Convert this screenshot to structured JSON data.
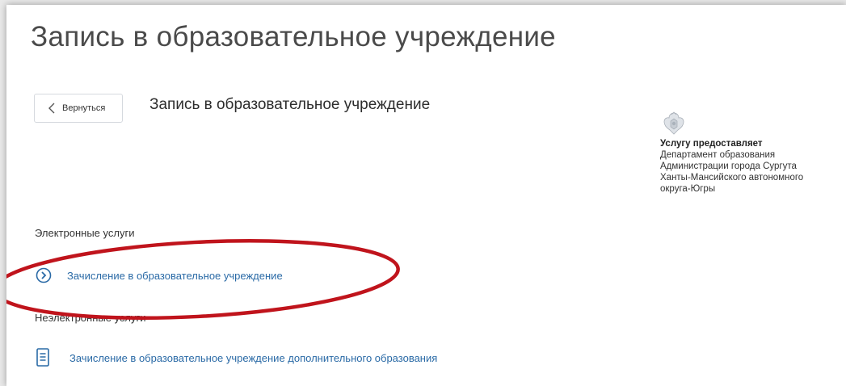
{
  "page": {
    "title": "Запись в образовательное учреждение"
  },
  "back_button": {
    "label": "Вернуться"
  },
  "service": {
    "title": "Запись в образовательное учреждение"
  },
  "provider": {
    "heading": "Услугу предоставляет",
    "lines": [
      "Департамент образования",
      "Администрации города Сургута",
      "Ханты-Мансийского автономного",
      "округа-Югры"
    ]
  },
  "electronic": {
    "heading": "Электронные услуги",
    "items": [
      {
        "label": "Зачисление в образовательное учреждение",
        "icon": "chevron-circle-icon"
      }
    ]
  },
  "non_electronic": {
    "heading": "Неэлектронные услуги",
    "items": [
      {
        "label": "Зачисление в образовательное учреждение дополнительного образования",
        "icon": "document-icon"
      }
    ]
  },
  "colors": {
    "link": "#2a6aa6",
    "annotation": "#c0141c",
    "title_text": "#4a4a4a"
  }
}
